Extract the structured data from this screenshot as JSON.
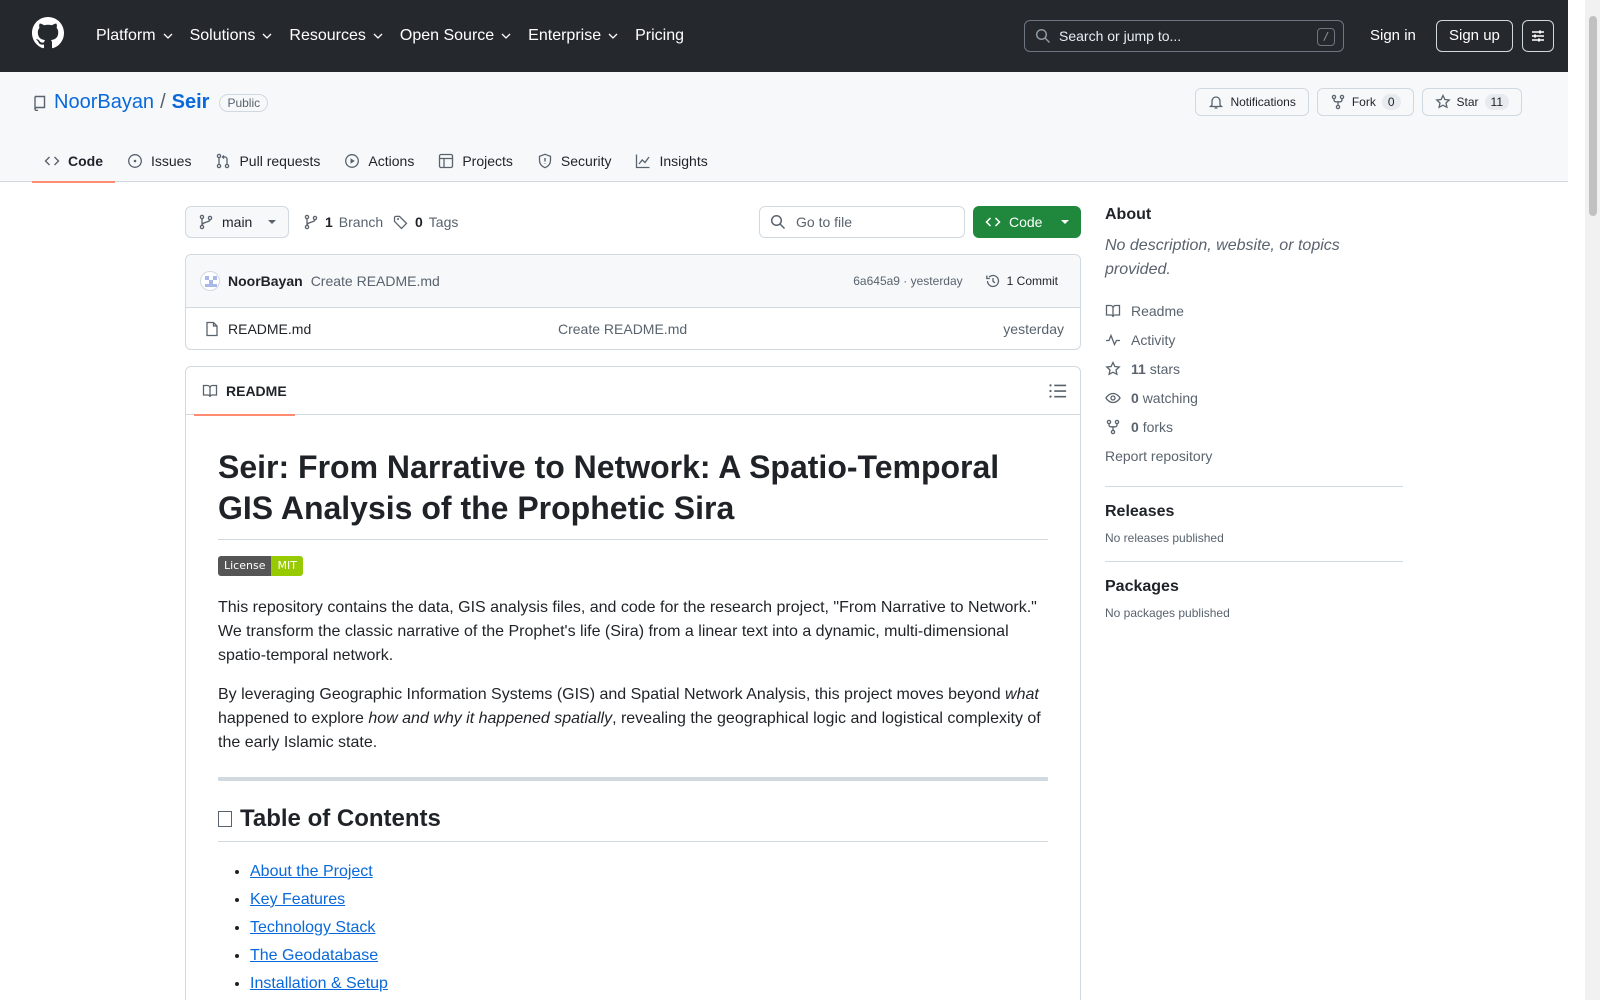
{
  "header": {
    "nav": [
      "Platform",
      "Solutions",
      "Resources",
      "Open Source",
      "Enterprise",
      "Pricing"
    ],
    "search_placeholder": "Search or jump to...",
    "search_shortcut": "/",
    "signin": "Sign in",
    "signup": "Sign up"
  },
  "repo": {
    "owner": "NoorBayan",
    "separator": "/",
    "name": "Seir",
    "visibility": "Public",
    "notifications_label": "Notifications",
    "fork_label": "Fork",
    "fork_count": "0",
    "star_label": "Star",
    "star_count": "11",
    "tabs": [
      "Code",
      "Issues",
      "Pull requests",
      "Actions",
      "Projects",
      "Security",
      "Insights"
    ]
  },
  "toolbar": {
    "branch": "main",
    "branch_count": "1",
    "branch_label": "Branch",
    "tag_count": "0",
    "tag_label": "Tags",
    "goto_placeholder": "Go to file",
    "code_button": "Code"
  },
  "commit": {
    "author": "NoorBayan",
    "message": "Create README.md",
    "meta": "6a645a9 · yesterday",
    "count_label": "1 Commit"
  },
  "files": [
    {
      "name": "README.md",
      "commit": "Create README.md",
      "age": "yesterday"
    }
  ],
  "readme": {
    "tab_label": "README",
    "title": "Seir: From Narrative to Network: A Spatio-Temporal GIS Analysis of the Prophetic Sira",
    "badge_left": "License",
    "badge_right": "MIT",
    "para1": "This repository contains the data, GIS analysis files, and code for the research project, \"From Narrative to Network.\" We transform the classic narrative of the Prophet's life (Sira) from a linear text into a dynamic, multi-dimensional spatio-temporal network.",
    "para2_a": "By leveraging Geographic Information Systems (GIS) and Spatial Network Analysis, this project moves beyond ",
    "para2_em1": "what",
    "para2_b": " happened to explore ",
    "para2_em2": "how and why it happened spatially",
    "para2_c": ", revealing the geographical logic and logistical complexity of the early Islamic state.",
    "toc_heading": "Table of Contents",
    "toc": [
      "About the Project",
      "Key Features",
      "Technology Stack",
      "The Geodatabase",
      "Installation & Setup"
    ]
  },
  "sidebar": {
    "about_heading": "About",
    "about_desc": "No description, website, or topics provided.",
    "readme": "Readme",
    "activity": "Activity",
    "stars_count": "11",
    "stars_label": "stars",
    "watching_count": "0",
    "watching_label": "watching",
    "forks_count": "0",
    "forks_label": "forks",
    "report": "Report repository",
    "releases_heading": "Releases",
    "releases_empty": "No releases published",
    "packages_heading": "Packages",
    "packages_empty": "No packages published"
  }
}
